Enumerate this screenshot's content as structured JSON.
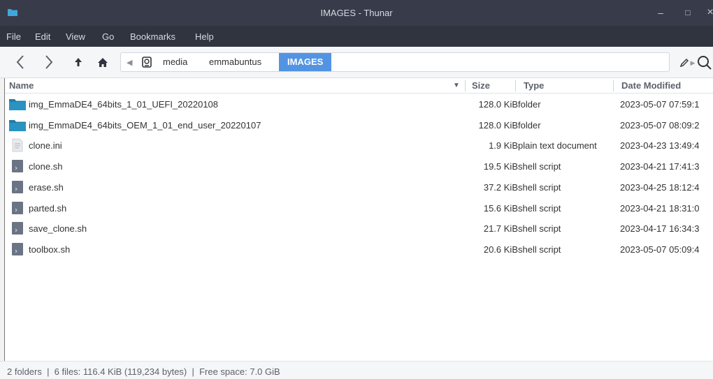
{
  "window": {
    "title": "IMAGES - Thunar",
    "app_icon": "folder-icon",
    "controls": {
      "minimize": "–",
      "maximize": "□",
      "close": "×"
    }
  },
  "menubar": {
    "items": [
      "File",
      "Edit",
      "View",
      "Go",
      "Bookmarks",
      "Help"
    ]
  },
  "toolbar": {
    "back_icon": "chevron-left-icon",
    "forward_icon": "chevron-right-icon",
    "up_icon": "arrow-up-icon",
    "home_icon": "home-icon",
    "edit_icon": "pencil-icon",
    "search_icon": "search-icon"
  },
  "breadcrumb": {
    "items": [
      "media",
      "emmabuntus",
      "IMAGES"
    ],
    "active": "IMAGES"
  },
  "columns": {
    "name": "Name",
    "size": "Size",
    "type": "Type",
    "date": "Date Modified"
  },
  "files": [
    {
      "name": "img_EmmaDE4_64bits_1_01_UEFI_20220108",
      "size": "128.0 KiB",
      "type": "folder",
      "date": "2023-05-07 07:59:1",
      "icon": "folder-icon"
    },
    {
      "name": "img_EmmaDE4_64bits_OEM_1_01_end_user_20220107",
      "size": "128.0 KiB",
      "type": "folder",
      "date": "2023-05-07 08:09:2",
      "icon": "folder-icon"
    },
    {
      "name": "clone.ini",
      "size": "1.9 KiB",
      "type": "plain text document",
      "date": "2023-04-23 13:49:4",
      "icon": "text-file-icon"
    },
    {
      "name": "clone.sh",
      "size": "19.5 KiB",
      "type": "shell script",
      "date": "2023-04-21 17:41:3",
      "icon": "script-file-icon"
    },
    {
      "name": "erase.sh",
      "size": "37.2 KiB",
      "type": "shell script",
      "date": "2023-04-25 18:12:4",
      "icon": "script-file-icon"
    },
    {
      "name": "parted.sh",
      "size": "15.6 KiB",
      "type": "shell script",
      "date": "2023-04-21 18:31:0",
      "icon": "script-file-icon"
    },
    {
      "name": "save_clone.sh",
      "size": "21.7 KiB",
      "type": "shell script",
      "date": "2023-04-17 16:34:3",
      "icon": "script-file-icon"
    },
    {
      "name": "toolbox.sh",
      "size": "20.6 KiB",
      "type": "shell script",
      "date": "2023-05-07 05:09:4",
      "icon": "script-file-icon"
    }
  ],
  "statusbar": {
    "text": "2 folders  |  6 files: 116.4 KiB (119,234 bytes)  |  Free space: 7.0 GiB"
  },
  "colors": {
    "titlebar": "#383c4a",
    "menubar": "#2f343f",
    "accent": "#5294e2",
    "folder": "#2a7fa7"
  }
}
